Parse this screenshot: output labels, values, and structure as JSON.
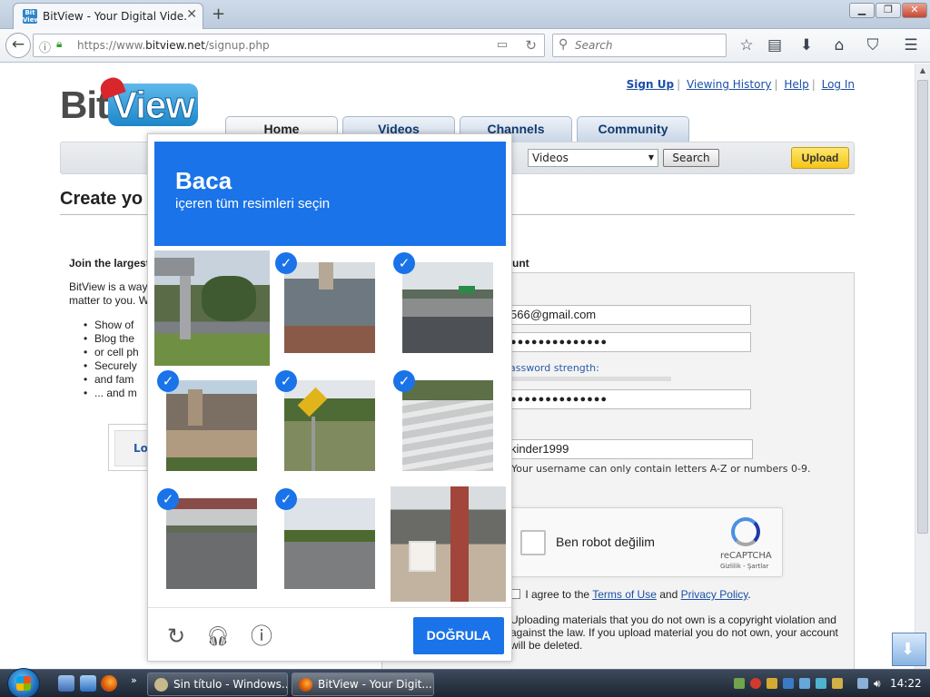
{
  "browser": {
    "tab_title": "BitView - Your Digital Vide...",
    "favicon_text": "Bit\nView",
    "url_prefix": "https://www.",
    "url_domain": "bitview.net",
    "url_path": "/signup.php",
    "search_placeholder": "Search"
  },
  "site": {
    "logo_bit": "Bit",
    "logo_view": "View",
    "top_links": [
      "Sign Up",
      "Viewing History",
      "Help",
      "Log In"
    ],
    "tabs": [
      "Home",
      "Videos",
      "Channels",
      "Community"
    ],
    "category_value": "Videos",
    "search_button": "Search",
    "upload_button": "Upload"
  },
  "main": {
    "title": "Create yo",
    "join_heading": "Join the largest",
    "intro_lines": [
      "BitView is a way",
      "matter to you. W"
    ],
    "bullets": [
      "Show of",
      "Blog the",
      "or cell ph",
      "Securely",
      "and fam",
      "... and m"
    ],
    "login_label": "Lo",
    "account_heading": "unt"
  },
  "form": {
    "email": "566@gmail.com",
    "password": "●●●●●●●●●●●●●●",
    "password_strength_label": "assword strength:",
    "confirm_password": "●●●●●●●●●●●●●●",
    "username": "kinder1999",
    "username_hint": "Your username can only contain letters A-Z or numbers 0-9.",
    "recaptcha_label": "Ben robot değilim",
    "recaptcha_name": "reCAPTCHA",
    "recaptcha_terms": "Gizlilik - Şartlar",
    "agree_prefix": "I agree to the",
    "terms_link": "Terms of Use",
    "agree_and": "and",
    "privacy_link": "Privacy Policy",
    "agree_suffix": ".",
    "warning": "Uploading materials that you do not own is a copyright violation and against the law. If you upload material you do not own, your account will be deleted."
  },
  "challenge": {
    "keyword": "Baca",
    "instruction": "içeren tüm resimleri seçin",
    "tiles": [
      {
        "name": "tile-1",
        "selected": false
      },
      {
        "name": "tile-2",
        "selected": true
      },
      {
        "name": "tile-3",
        "selected": true
      },
      {
        "name": "tile-4",
        "selected": true
      },
      {
        "name": "tile-5",
        "selected": true
      },
      {
        "name": "tile-6",
        "selected": true
      },
      {
        "name": "tile-7",
        "selected": true
      },
      {
        "name": "tile-8",
        "selected": true
      },
      {
        "name": "tile-9",
        "selected": false
      }
    ],
    "verify_button": "DOĞRULA",
    "icons": [
      "reload-icon",
      "audio-icon",
      "info-icon"
    ],
    "accent_color": "#1a73e8"
  },
  "taskbar": {
    "tasks": [
      "Sin título - Windows...",
      "BitView - Your Digit..."
    ],
    "clock": "14:22"
  }
}
